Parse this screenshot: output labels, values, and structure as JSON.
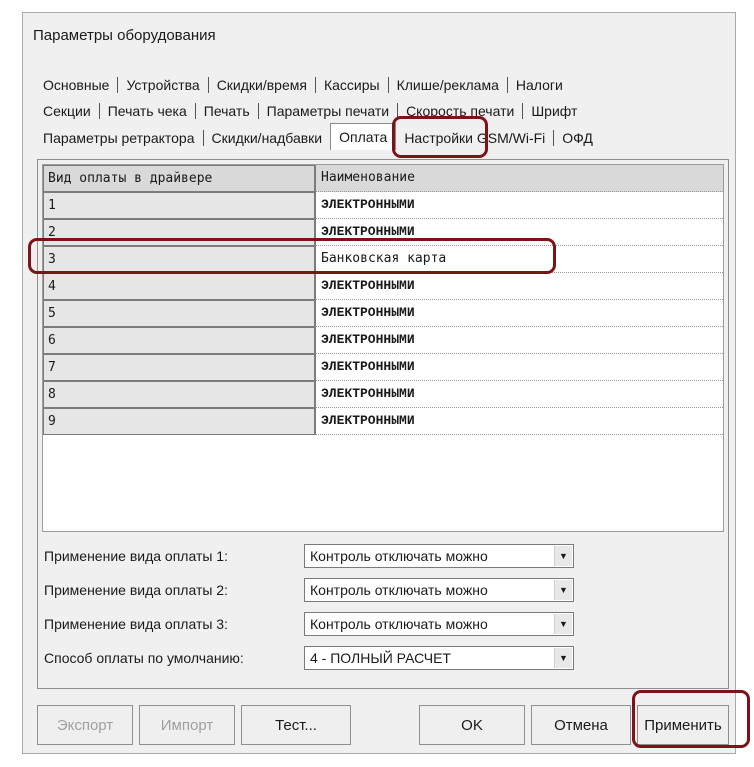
{
  "window": {
    "title": "Параметры оборудования"
  },
  "tabs": {
    "row1": [
      "Основные",
      "Устройства",
      "Скидки/время",
      "Кассиры",
      "Клише/реклама",
      "Налоги"
    ],
    "row2": [
      "Секции",
      "Печать чека",
      "Печать",
      "Параметры печати",
      "Скорость печати",
      "Шрифт"
    ],
    "row3": [
      "Параметры ретрактора",
      "Скидки/надбавки",
      "Оплата",
      "Настройки GSM/Wi-Fi",
      "ОФД"
    ]
  },
  "grid": {
    "col1_header": "Вид оплаты в драйвере",
    "col2_header": "Наименование",
    "rows": [
      {
        "id": "1",
        "name": "ЭЛЕКТРОННЫМИ"
      },
      {
        "id": "2",
        "name": "ЭЛЕКТРОННЫМИ"
      },
      {
        "id": "3",
        "name": "Банковская карта"
      },
      {
        "id": "4",
        "name": "ЭЛЕКТРОННЫМИ"
      },
      {
        "id": "5",
        "name": "ЭЛЕКТРОННЫМИ"
      },
      {
        "id": "6",
        "name": "ЭЛЕКТРОННЫМИ"
      },
      {
        "id": "7",
        "name": "ЭЛЕКТРОННЫМИ"
      },
      {
        "id": "8",
        "name": "ЭЛЕКТРОННЫМИ"
      },
      {
        "id": "9",
        "name": "ЭЛЕКТРОННЫМИ"
      }
    ]
  },
  "fields": [
    {
      "label": "Применение вида оплаты 1:",
      "value": "Контроль отключать можно"
    },
    {
      "label": "Применение вида оплаты 2:",
      "value": "Контроль отключать можно"
    },
    {
      "label": "Применение вида оплаты 3:",
      "value": "Контроль отключать можно"
    },
    {
      "label": "Способ оплаты по умолчанию:",
      "value": "4 - ПОЛНЫЙ РАСЧЕТ"
    }
  ],
  "buttons": {
    "export": "Экспорт",
    "import": "Импорт",
    "test": "Тест...",
    "ok": "OK",
    "cancel": "Отмена",
    "apply": "Применить"
  },
  "colors": {
    "highlight": "#7a1418"
  }
}
